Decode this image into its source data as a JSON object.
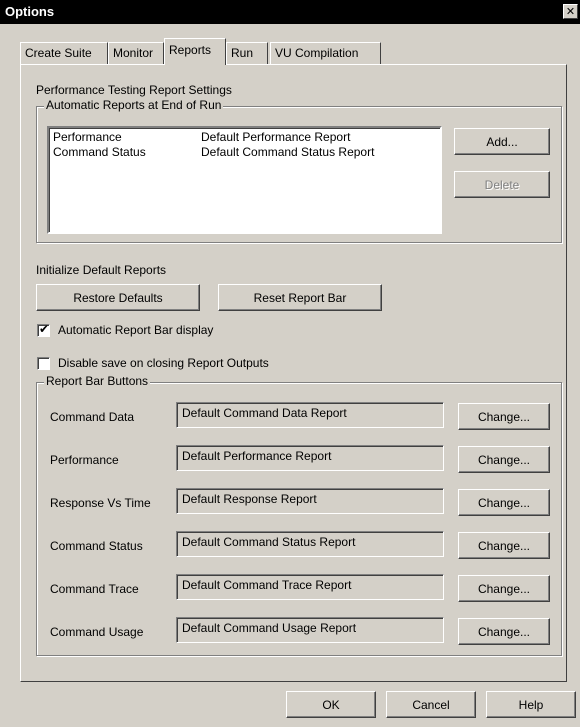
{
  "window": {
    "title": "Options",
    "close_glyph": "✕"
  },
  "tabs": [
    {
      "label": "Create Suite",
      "active": false
    },
    {
      "label": "Monitor",
      "active": false
    },
    {
      "label": "Reports",
      "active": true
    },
    {
      "label": "Run",
      "active": false
    },
    {
      "label": "VU Compilation",
      "active": false
    }
  ],
  "section_title": "Performance Testing Report Settings",
  "auto_reports": {
    "legend": "Automatic Reports at End of Run",
    "rows": [
      {
        "name": "Performance",
        "report": "Default Performance Report"
      },
      {
        "name": "Command Status",
        "report": "Default Command Status Report"
      }
    ],
    "add_label": "Add...",
    "delete_label": "Delete"
  },
  "init_defaults": {
    "label": "Initialize Default Reports",
    "restore_label": "Restore Defaults",
    "reset_label": "Reset Report Bar"
  },
  "checkboxes": {
    "auto_bar": {
      "label": "Automatic Report Bar display",
      "checked": true,
      "mark": "✔"
    },
    "disable_save": {
      "label": "Disable save on closing Report Outputs",
      "checked": false
    }
  },
  "report_bar": {
    "legend": "Report Bar Buttons",
    "change_label": "Change...",
    "rows": [
      {
        "label": "Command Data",
        "value": "Default Command Data Report"
      },
      {
        "label": "Performance",
        "value": "Default Performance Report"
      },
      {
        "label": "Response Vs Time",
        "value": "Default Response Report"
      },
      {
        "label": "Command Status",
        "value": "Default Command Status Report"
      },
      {
        "label": "Command Trace",
        "value": "Default Command Trace Report"
      },
      {
        "label": "Command Usage",
        "value": "Default Command Usage Report"
      }
    ]
  },
  "footer": {
    "ok_label": "OK",
    "cancel_label": "Cancel",
    "help_label": "Help"
  }
}
